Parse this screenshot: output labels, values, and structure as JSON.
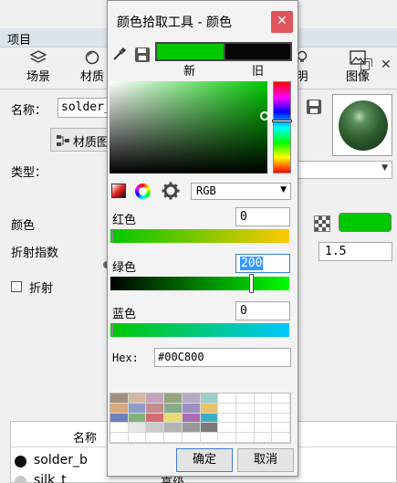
{
  "panel": {
    "title": "项目",
    "tabs": [
      {
        "label": "场景",
        "icon": "scene-icon"
      },
      {
        "label": "材质",
        "icon": "material-icon"
      },
      {
        "label": "明",
        "icon": "lighting-icon"
      },
      {
        "label": "图像",
        "icon": "image-icon"
      }
    ],
    "name_label": "名称：",
    "name_value": "solder_b",
    "material_button": "材质图",
    "type_label": "类型：",
    "color_label": "颜色",
    "color_value": "#00c800",
    "refraction_index_label": "折射指数",
    "refraction_index_value": "1.5",
    "refraction_label": "折射",
    "layer_table": {
      "header_name": "名称",
      "rows": [
        {
          "name": "solder_b",
          "col2": ""
        },
        {
          "name": "silk_t",
          "col2": "高级"
        }
      ]
    }
  },
  "dialog": {
    "title": "颜色拾取工具 - 颜色",
    "close": "✕",
    "new_label": "新",
    "old_label": "旧",
    "new_color": "#00c800",
    "old_color": "#060606",
    "mode_value": "RGB",
    "channels": {
      "red": {
        "label": "红色",
        "value": "0"
      },
      "green": {
        "label": "绿色",
        "value": "200"
      },
      "blue": {
        "label": "蓝色",
        "value": "0"
      }
    },
    "hex_label": "Hex:",
    "hex_value": "#00C800",
    "swatches": [
      "#a0907f",
      "#d5b8a3",
      "#c4a4bc",
      "#98a47d",
      "#b7a9c5",
      "#9ccfcb",
      "#ffffff",
      "#ffffff",
      "#ffffff",
      "#ffffff",
      "#dba97b",
      "#8d9ecb",
      "#c68b8e",
      "#89ab8b",
      "#9d90c1",
      "#e9c36c",
      "#ffffff",
      "#ffffff",
      "#ffffff",
      "#ffffff",
      "#6d80b9",
      "#82b37a",
      "#d36b72",
      "#e7db71",
      "#a96db1",
      "#3ab0c6",
      "#ffffff",
      "#ffffff",
      "#ffffff",
      "#ffffff",
      "#ffffff",
      "#e6e6e6",
      "#cbcbcb",
      "#b3b3b3",
      "#999999",
      "#7a7a7a",
      "#ffffff",
      "#ffffff",
      "#ffffff",
      "#ffffff",
      "#ffffff",
      "#ffffff",
      "#ffffff",
      "#ffffff",
      "#ffffff",
      "#ffffff",
      "#ffffff",
      "#ffffff",
      "#ffffff",
      "#ffffff"
    ],
    "ok_label": "确定",
    "cancel_label": "取消"
  }
}
